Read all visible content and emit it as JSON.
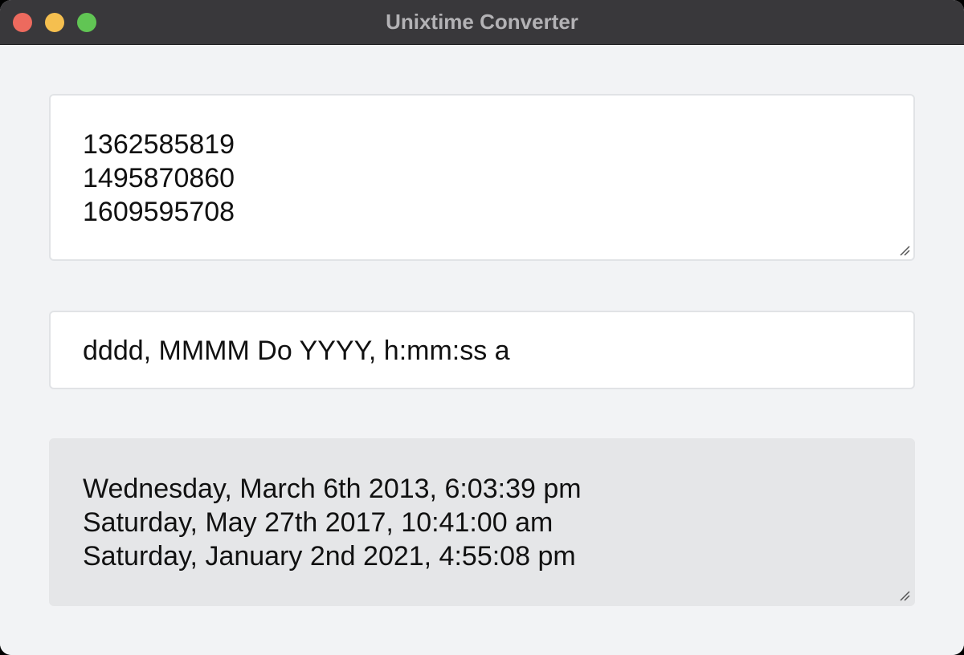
{
  "window": {
    "title": "Unixtime Converter"
  },
  "input": {
    "lines": [
      "1362585819",
      "1495870860",
      "1609595708"
    ]
  },
  "format": {
    "value": "dddd, MMMM Do YYYY, h:mm:ss a"
  },
  "output": {
    "lines": [
      "Wednesday, March 6th 2013, 6:03:39 pm",
      "Saturday, May 27th 2017, 10:41:00 am",
      "Saturday, January 2nd 2021, 4:55:08 pm"
    ]
  },
  "colors": {
    "close": "#ed6a5e",
    "minimize": "#f5bf4f",
    "maximize": "#61c554",
    "titlebar": "#39383b",
    "background": "#f2f3f5",
    "output_background": "#e5e6e8"
  }
}
